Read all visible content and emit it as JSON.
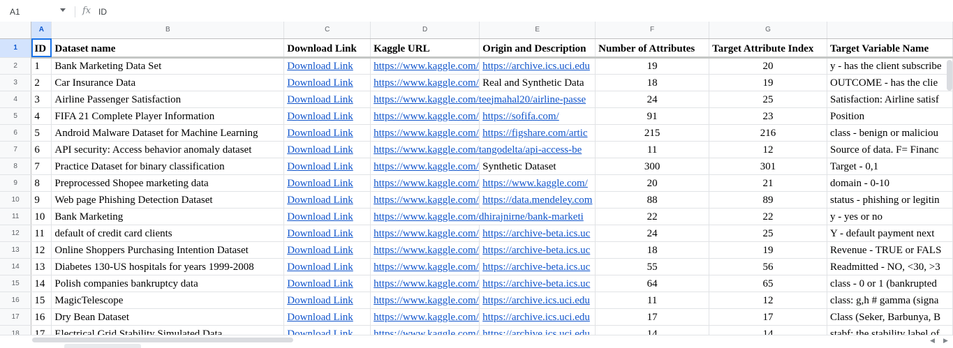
{
  "formula_bar": {
    "cell_ref": "A1",
    "fx": "fx",
    "value": "ID"
  },
  "columns": [
    "A",
    "B",
    "C",
    "D",
    "E",
    "F",
    "G"
  ],
  "header": {
    "row_number": "1",
    "cells": [
      "ID",
      "Dataset name",
      "Download Link",
      "Kaggle URL",
      "Origin and Description",
      "Number of Attributes",
      "Target Attribute Index",
      "Target Variable Name"
    ]
  },
  "rows": [
    {
      "n": "2",
      "id": "1",
      "name": "Bank Marketing Data Set",
      "dl": "Download Link",
      "kaggle": "https://www.kaggle.com/",
      "origin": "https://archive.ics.uci.edu",
      "attrs": "19",
      "idx": "20",
      "target": "y - has the client subscribe"
    },
    {
      "n": "3",
      "id": "2",
      "name": "Car Insurance Data",
      "dl": "Download Link",
      "kaggle": "https://www.kaggle.com/",
      "origin": "Real and Synthetic Data",
      "attrs": "18",
      "idx": "19",
      "target": "OUTCOME - has the clie"
    },
    {
      "n": "4",
      "id": "3",
      "name": "Airline Passenger Satisfaction",
      "dl": "Download Link",
      "kaggle": "https://www.kaggle.com/teejmahal20/airline-passe",
      "origin": "",
      "attrs": "24",
      "idx": "25",
      "target": "Satisfaction: Airline satisf"
    },
    {
      "n": "5",
      "id": "4",
      "name": "FIFA 21 Complete Player Information",
      "dl": "Download Link",
      "kaggle": "https://www.kaggle.com/",
      "origin": "https://sofifa.com/",
      "attrs": "91",
      "idx": "23",
      "target": "Position"
    },
    {
      "n": "6",
      "id": "5",
      "name": "Android Malware Dataset for Machine Learning",
      "dl": "Download Link",
      "kaggle": "https://www.kaggle.com/",
      "origin": "https://figshare.com/artic",
      "attrs": "215",
      "idx": "216",
      "target": "class - benign or maliciou"
    },
    {
      "n": "7",
      "id": "6",
      "name": "API security: Access behavior anomaly dataset",
      "dl": "Download Link",
      "kaggle": "https://www.kaggle.com/tangodelta/api-access-be",
      "origin": "",
      "attrs": "11",
      "idx": "12",
      "target": "Source of data. F= Financ"
    },
    {
      "n": "8",
      "id": "7",
      "name": "Practice Dataset for binary classification",
      "dl": "Download Link",
      "kaggle": "https://www.kaggle.com/",
      "origin": "Synthetic Dataset",
      "attrs": "300",
      "idx": "301",
      "target": "Target - 0,1"
    },
    {
      "n": "9",
      "id": "8",
      "name": "Preprocessed Shopee marketing data",
      "dl": "Download Link",
      "kaggle": "https://www.kaggle.com/",
      "origin": "https://www.kaggle.com/",
      "attrs": "20",
      "idx": "21",
      "target": "domain - 0-10"
    },
    {
      "n": "10",
      "id": "9",
      "name": "Web page Phishing Detection Dataset",
      "dl": "Download Link",
      "kaggle": "https://www.kaggle.com/",
      "origin": "https://data.mendeley.com",
      "attrs": "88",
      "idx": "89",
      "target": "status - phishing or legitin"
    },
    {
      "n": "11",
      "id": "10",
      "name": "Bank Marketing",
      "dl": "Download Link",
      "kaggle": "https://www.kaggle.com/dhirajnirne/bank-marketi",
      "origin": "",
      "attrs": "22",
      "idx": "22",
      "target": "y - yes or no"
    },
    {
      "n": "12",
      "id": "11",
      "name": "default of credit card clients",
      "dl": "Download Link",
      "kaggle": "https://www.kaggle.com/",
      "origin": "https://archive-beta.ics.uc",
      "attrs": "24",
      "idx": "25",
      "target": "Y - default payment next"
    },
    {
      "n": "13",
      "id": "12",
      "name": "Online Shoppers Purchasing Intention Dataset",
      "dl": "Download Link",
      "kaggle": "https://www.kaggle.com/",
      "origin": "https://archive-beta.ics.uc",
      "attrs": "18",
      "idx": "19",
      "target": "Revenue - TRUE or FALS"
    },
    {
      "n": "14",
      "id": "13",
      "name": "Diabetes 130-US hospitals for years 1999-2008",
      "dl": "Download Link",
      "kaggle": "https://www.kaggle.com/",
      "origin": "https://archive-beta.ics.uc",
      "attrs": "55",
      "idx": "56",
      "target": "Readmitted - NO, <30, >3"
    },
    {
      "n": "15",
      "id": "14",
      "name": "Polish companies bankruptcy data",
      "dl": "Download Link",
      "kaggle": "https://www.kaggle.com/",
      "origin": "https://archive-beta.ics.uc",
      "attrs": "64",
      "idx": "65",
      "target": "class - 0 or 1 (bankrupted"
    },
    {
      "n": "16",
      "id": "15",
      "name": "MagicTelescope",
      "dl": "Download Link",
      "kaggle": "https://www.kaggle.com/",
      "origin": "https://archive.ics.uci.edu",
      "attrs": "11",
      "idx": "12",
      "target": "class: g,h # gamma (signa"
    },
    {
      "n": "17",
      "id": "16",
      "name": "Dry Bean Dataset",
      "dl": "Download Link",
      "kaggle": "https://www.kaggle.com/",
      "origin": "https://archive.ics.uci.edu",
      "attrs": "17",
      "idx": "17",
      "target": "Class (Seker, Barbunya, B"
    },
    {
      "n": "18",
      "id": "17",
      "name": "Electrical Grid Stability Simulated Data",
      "dl": "Download Link",
      "kaggle": "https://www.kaggle.com/",
      "origin": "https://archive.ics.uci.edu",
      "attrs": "14",
      "idx": "14",
      "target": "stabf: the stability label of"
    }
  ]
}
